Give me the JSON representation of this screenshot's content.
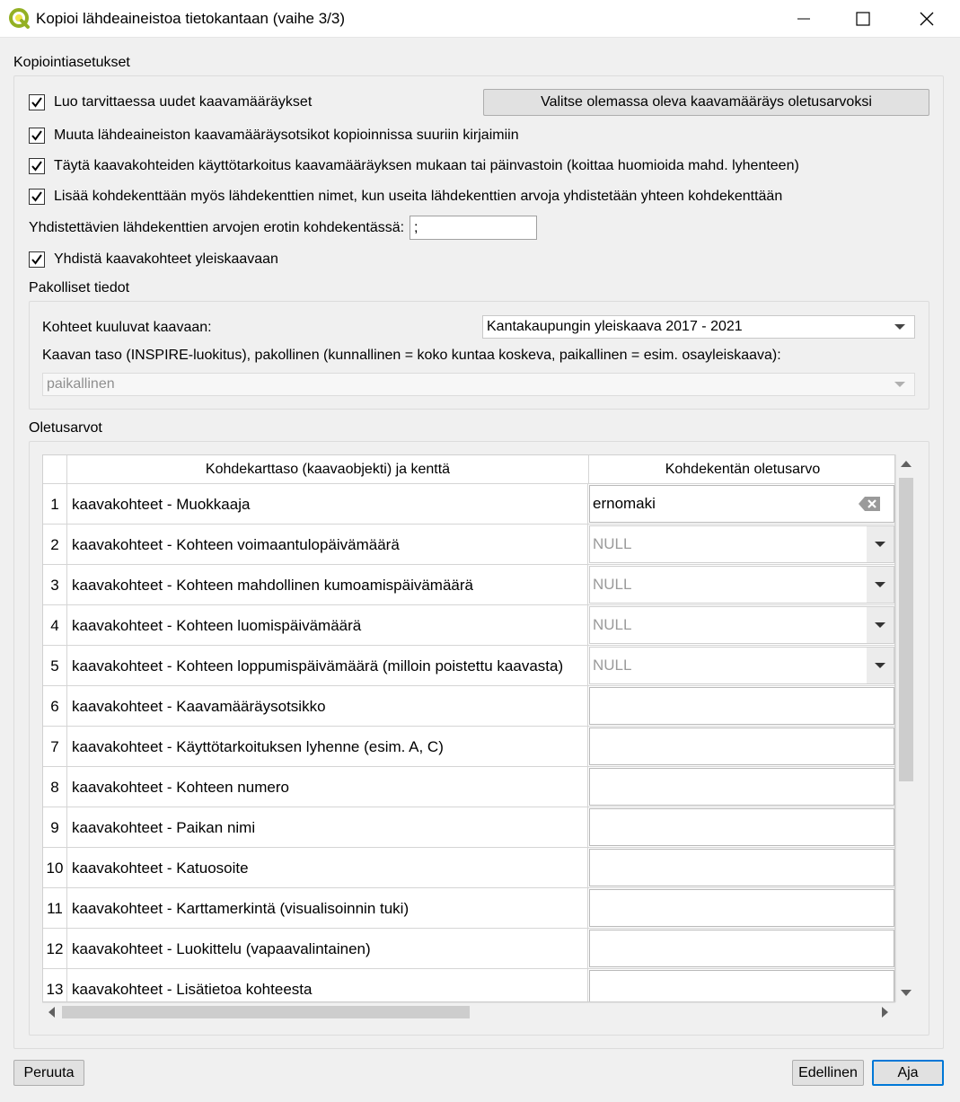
{
  "window": {
    "title": "Kopioi lähdeaineistoa tietokantaan (vaihe 3/3)",
    "controls": {
      "minimize": "—",
      "maximize": "☐",
      "close": "✕"
    }
  },
  "copy_settings": {
    "group_title": "Kopiointiasetukset",
    "checkboxes": [
      {
        "label": "Luo tarvittaessa uudet kaavamääräykset",
        "checked": true
      },
      {
        "label": "Muuta lähdeaineiston kaavamääräysotsikot kopioinnissa suuriin kirjaimiin",
        "checked": true
      },
      {
        "label": "Täytä kaavakohteiden käyttötarkoitus kaavamääräyksen mukaan tai päinvastoin (koittaa huomioida mahd. lyhenteen)",
        "checked": true
      },
      {
        "label": "Lisää kohdekenttään myös lähdekenttien nimet, kun useita lähdekenttien arvoja yhdistetään yhteen kohdekenttään",
        "checked": true
      }
    ],
    "select_default_button": "Valitse olemassa oleva kaavamääräys oletusarvoksi",
    "separator_label": "Yhdistettävien lähdekenttien arvojen erotin kohdekentässä:",
    "separator_value": ";",
    "merge_checkbox": {
      "label": "Yhdistä kaavakohteet yleiskaavaan",
      "checked": true
    }
  },
  "mandatory": {
    "group_title": "Pakolliset tiedot",
    "plan_label": "Kohteet kuuluvat kaavaan:",
    "plan_value": "Kantakaupungin yleiskaava 2017 - 2021",
    "level_label": "Kaavan taso (INSPIRE-luokitus), pakollinen (kunnallinen = koko kuntaa koskeva, paikallinen = esim. osayleiskaava):",
    "level_value": "paikallinen"
  },
  "defaults": {
    "group_title": "Oletusarvot",
    "columns": [
      "Kohdekarttaso (kaavaobjekti) ja kenttä",
      "Kohdekentän oletusarvo"
    ],
    "rows": [
      {
        "num": "1",
        "field": "kaavakohteet - Muokkaaja",
        "value": "ernomaki",
        "kind": "text"
      },
      {
        "num": "2",
        "field": "kaavakohteet - Kohteen voimaantulopäivämäärä",
        "value": "NULL",
        "kind": "date"
      },
      {
        "num": "3",
        "field": "kaavakohteet - Kohteen mahdollinen kumoamispäivämäärä",
        "value": "NULL",
        "kind": "date"
      },
      {
        "num": "4",
        "field": "kaavakohteet - Kohteen luomispäivämäärä",
        "value": "NULL",
        "kind": "date"
      },
      {
        "num": "5",
        "field": "kaavakohteet - Kohteen loppumispäivämäärä (milloin poistettu kaavasta)",
        "value": "NULL",
        "kind": "date"
      },
      {
        "num": "6",
        "field": "kaavakohteet - Kaavamääräysotsikko",
        "value": "",
        "kind": "empty"
      },
      {
        "num": "7",
        "field": "kaavakohteet - Käyttötarkoituksen lyhenne (esim. A, C)",
        "value": "",
        "kind": "empty"
      },
      {
        "num": "8",
        "field": "kaavakohteet - Kohteen numero",
        "value": "",
        "kind": "empty"
      },
      {
        "num": "9",
        "field": "kaavakohteet - Paikan nimi",
        "value": "",
        "kind": "empty"
      },
      {
        "num": "10",
        "field": "kaavakohteet - Katuosoite",
        "value": "",
        "kind": "empty"
      },
      {
        "num": "11",
        "field": "kaavakohteet - Karttamerkintä (visualisoinnin tuki)",
        "value": "",
        "kind": "empty"
      },
      {
        "num": "12",
        "field": "kaavakohteet - Luokittelu (vapaavalintainen)",
        "value": "",
        "kind": "empty"
      },
      {
        "num": "13",
        "field": "kaavakohteet - Lisätietoa kohteesta",
        "value": "",
        "kind": "empty"
      }
    ]
  },
  "footer": {
    "cancel_button": "Peruuta",
    "previous_button": "Edellinen",
    "run_button": "Aja"
  },
  "colors": {
    "qgis_green": "#93b023",
    "qgis_yellow": "#f0e64a",
    "accent_border": "#0078d7"
  }
}
